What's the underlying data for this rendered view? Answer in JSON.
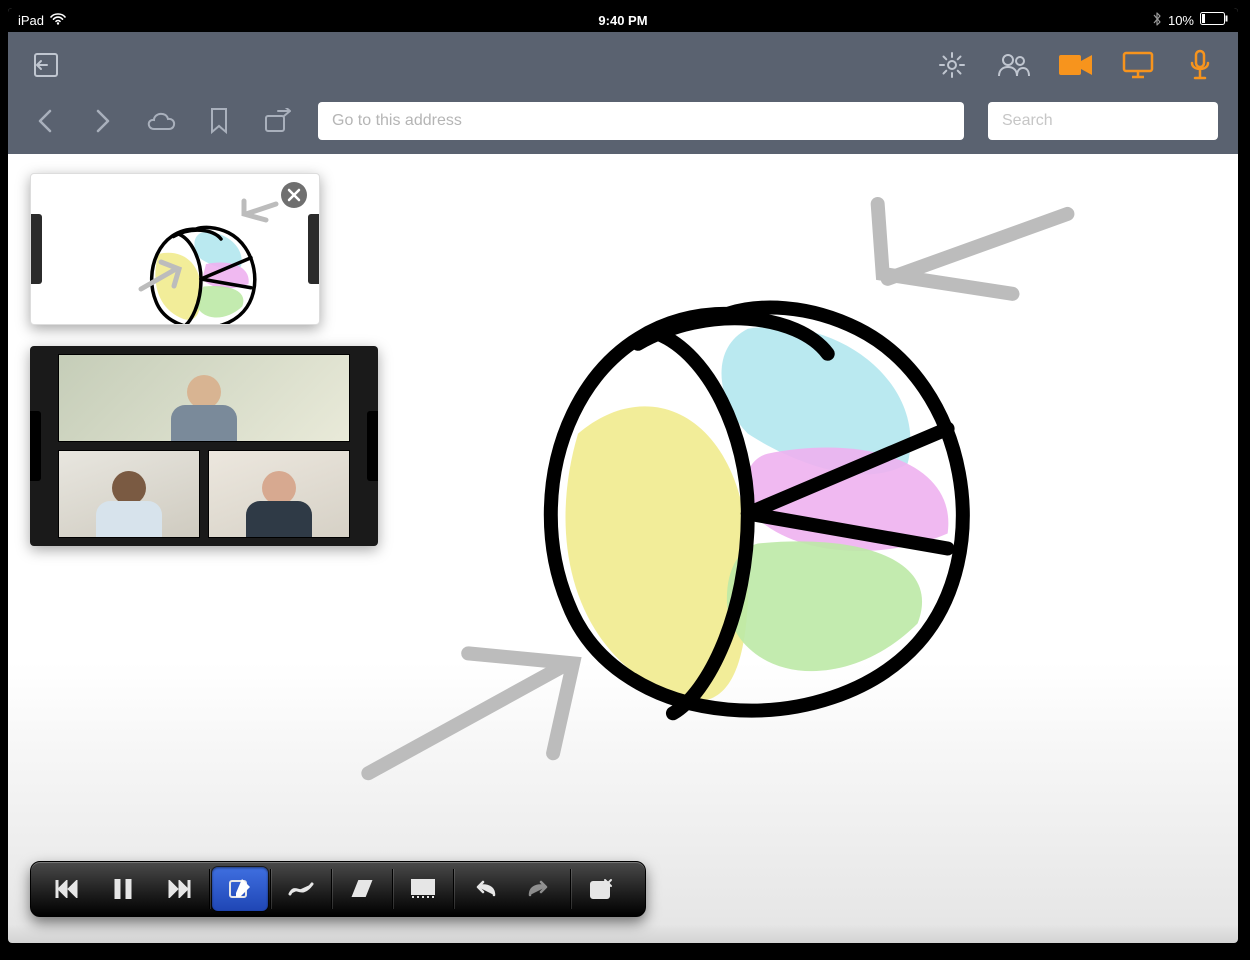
{
  "status": {
    "device_label": "iPad",
    "time": "9:40 PM",
    "battery_text": "10%"
  },
  "nav": {
    "address_placeholder": "Go to this address",
    "search_placeholder": "Search"
  },
  "colors": {
    "accent": "#f7941d",
    "toolbar_bg": "#5a6270",
    "stroke_gray": "#b0b0b0"
  },
  "chart_data": {
    "type": "pie",
    "title": "",
    "note": "Hand-drawn pie chart sketch; values estimated from slice angles",
    "series": [
      {
        "name": "Yellow",
        "value": 45,
        "color": "#f1eb8e"
      },
      {
        "name": "Blue",
        "value": 20,
        "color": "#b3e7ee"
      },
      {
        "name": "Pink",
        "value": 18,
        "color": "#eeb1ef"
      },
      {
        "name": "Green",
        "value": 17,
        "color": "#bce9a6"
      }
    ]
  },
  "video_panel": {
    "participants": 3
  },
  "bottom_toolbar": {
    "active_tool": "annotate"
  }
}
